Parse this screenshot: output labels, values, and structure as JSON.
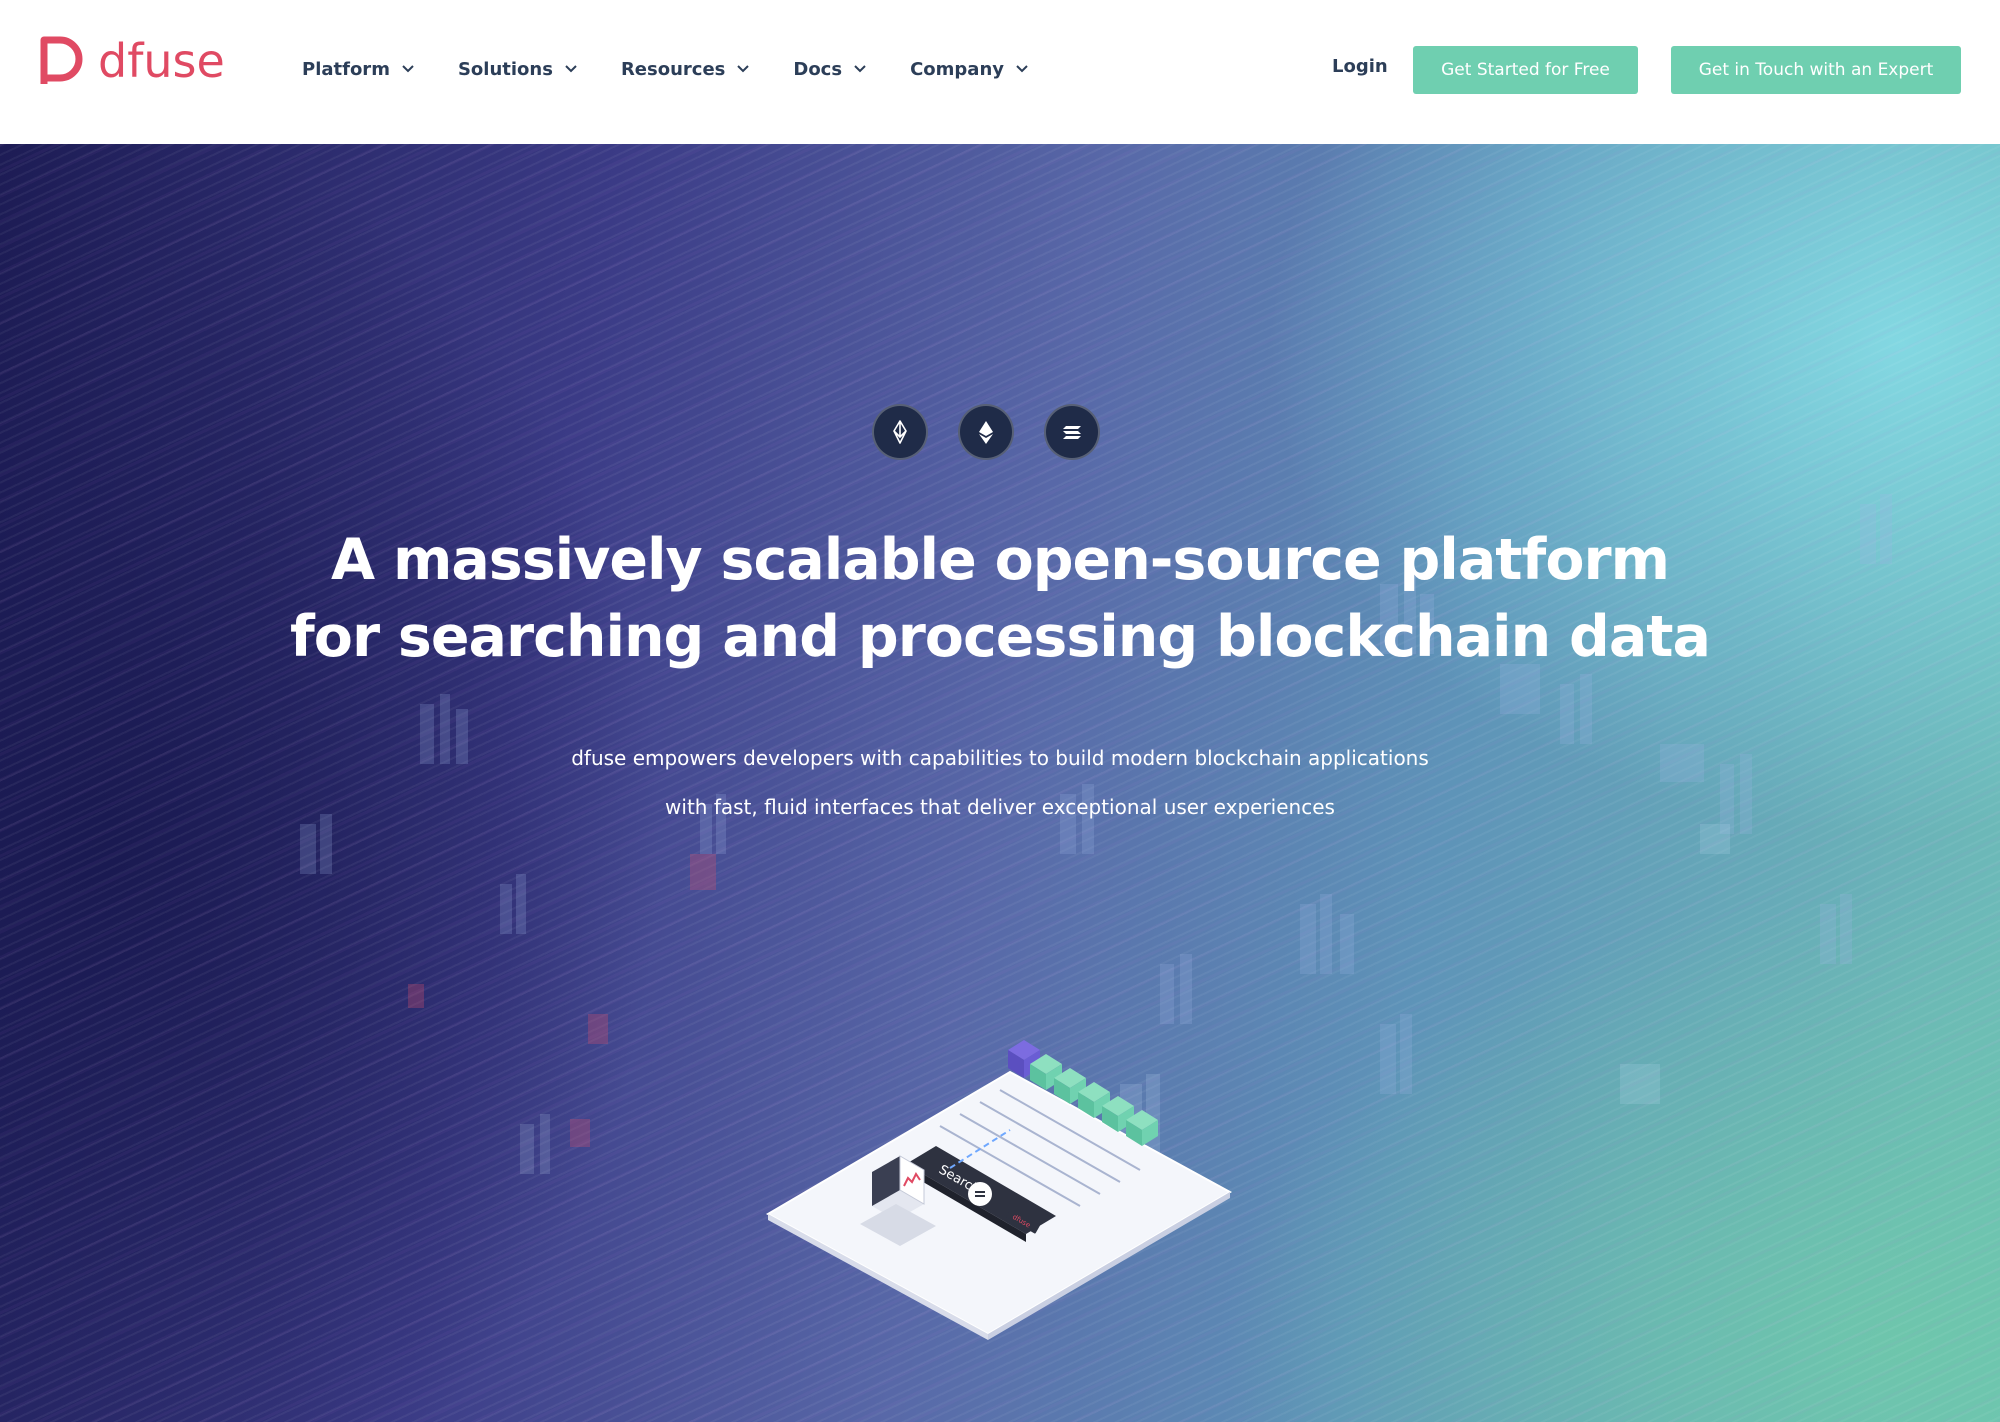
{
  "brand": {
    "name": "dfuse",
    "color": "#e04a63"
  },
  "nav": {
    "items": [
      {
        "label": "Platform"
      },
      {
        "label": "Solutions"
      },
      {
        "label": "Resources"
      },
      {
        "label": "Docs"
      },
      {
        "label": "Company"
      }
    ],
    "login_label": "Login",
    "cta_primary": "Get Started for Free",
    "cta_secondary": "Get in Touch with an Expert",
    "cta_color": "#6fcfb0"
  },
  "hero": {
    "chains": [
      {
        "icon": "eosio-icon"
      },
      {
        "icon": "ethereum-icon"
      },
      {
        "icon": "solana-icon"
      }
    ],
    "headline_line1": "A massively scalable open-source platform",
    "headline_line2": "for searching and processing blockchain data",
    "sub_line1": "dfuse empowers developers with capabilities to build modern blockchain applications",
    "sub_line2": "with fast, fluid interfaces that deliver exceptional user experiences",
    "illustration": {
      "search_label": "Search",
      "badge_label": "dfuse"
    }
  }
}
